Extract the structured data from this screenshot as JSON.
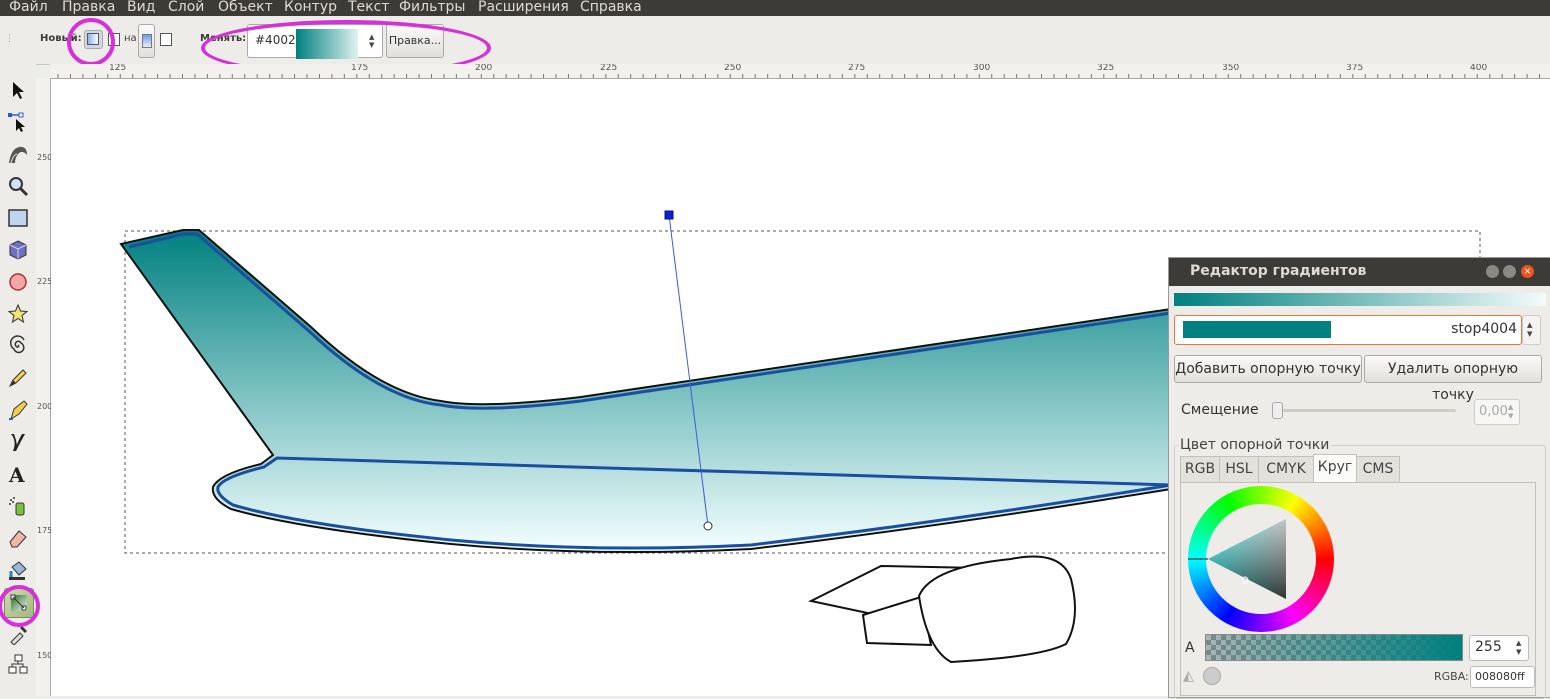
{
  "menu": [
    "Файл",
    "Правка",
    "Вид",
    "Слой",
    "Объект",
    "Контур",
    "Текст",
    "Фильтры",
    "Расширения",
    "Справка"
  ],
  "toolbar": {
    "new_label": "Новый:",
    "on_label": "на",
    "change_label": "Менять:",
    "gradient_id": "#4002",
    "edit_button": "Правка..."
  },
  "ruler_top": [
    "125",
    "175",
    "200",
    "225",
    "250",
    "275",
    "300",
    "325",
    "350",
    "375",
    "400"
  ],
  "ruler_left": [
    "250",
    "225",
    "200",
    "175",
    "150"
  ],
  "tools": [
    "selector-tool",
    "node-tool",
    "tweak-tool",
    "zoom-tool",
    "rectangle-tool",
    "3d-box-tool",
    "ellipse-tool",
    "star-tool",
    "spiral-tool",
    "pencil-tool",
    "pen-tool",
    "calligraphy-tool",
    "text-tool",
    "spray-tool",
    "eraser-tool",
    "paint-bucket-tool",
    "gradient-tool",
    "dropper-tool",
    "connector-tool"
  ],
  "gradient_editor": {
    "title": "Редактор градиентов",
    "stop_name": "stop4004",
    "add_stop": "Добавить опорную точку",
    "delete_stop": "Удалить опорную точку",
    "offset_label": "Смещение",
    "offset_value": "0,00",
    "stop_color_label": "Цвет опорной точки",
    "tabs": [
      "RGB",
      "HSL",
      "CMYK",
      "Круг",
      "CMS"
    ],
    "active_tab": "Круг",
    "alpha_label": "A",
    "alpha_value": "255",
    "rgba_label": "RGBA:",
    "rgba_value": "008080ff"
  },
  "colors": {
    "stop_color": "#008080",
    "highlight": "#d631d6",
    "menubar": "#3c3b37",
    "outline": "#1a4fa0"
  }
}
